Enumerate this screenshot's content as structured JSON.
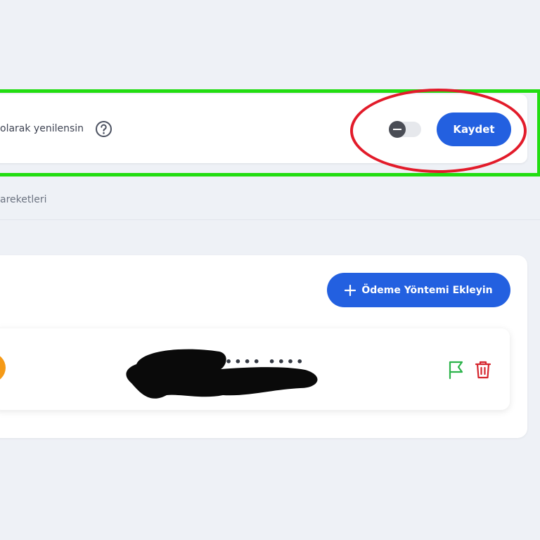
{
  "auto_renew": {
    "label": "olarak yenilensin",
    "help_icon": "question-circle-icon",
    "toggle_state": "off",
    "save_label": "Kaydet"
  },
  "section": {
    "tab_label": "areketleri"
  },
  "payment_methods": {
    "add_button_label": "Ödeme Yöntemi Ekleyin",
    "add_icon": "plus-icon",
    "items": [
      {
        "masked_number": "•••• ••••",
        "brand_icon": "card-brand-icon",
        "actions": {
          "default_icon": "flag-icon",
          "delete_icon": "trash-icon"
        }
      }
    ]
  },
  "colors": {
    "primary": "#2360e0",
    "background": "#eef1f6",
    "flag": "#2bb34a",
    "delete": "#d5262e",
    "annotation_green": "#22dd11",
    "annotation_red": "#e21b2a"
  }
}
